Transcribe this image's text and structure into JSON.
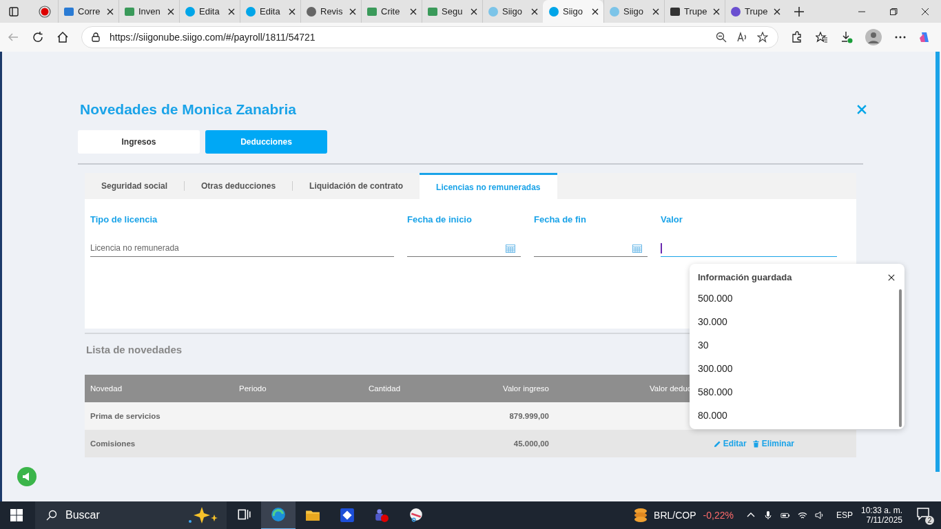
{
  "browser": {
    "tabs": [
      {
        "label": "Corre",
        "kind": "mail",
        "selected": false
      },
      {
        "label": "Inven",
        "kind": "sheet",
        "selected": false
      },
      {
        "label": "Edita",
        "kind": "siigo",
        "selected": false
      },
      {
        "label": "Edita",
        "kind": "siigo",
        "selected": false
      },
      {
        "label": "Revis",
        "kind": "chat",
        "selected": false
      },
      {
        "label": "Crite",
        "kind": "sheet",
        "selected": false
      },
      {
        "label": "Segu",
        "kind": "sheet",
        "selected": false
      },
      {
        "label": "Siigo",
        "kind": "siigo-light",
        "selected": false
      },
      {
        "label": "Siigo",
        "kind": "siigo",
        "selected": true
      },
      {
        "label": "Siigo",
        "kind": "siigo-light",
        "selected": false
      },
      {
        "label": "Trupe",
        "kind": "square",
        "selected": false
      },
      {
        "label": "Trupe",
        "kind": "circle",
        "selected": false
      }
    ],
    "url": "https://siigonube.siigo.com/#/payroll/1811/54721"
  },
  "page": {
    "title": "Novedades de Monica Zanabria",
    "main_tabs": [
      {
        "label": "Ingresos",
        "selected": false
      },
      {
        "label": "Deducciones",
        "selected": true
      }
    ],
    "sub_tabs": [
      {
        "label": "Seguridad social",
        "selected": false
      },
      {
        "label": "Otras deducciones",
        "selected": false
      },
      {
        "label": "Liquidación de contrato",
        "selected": false
      },
      {
        "label": "Licencias no remuneradas",
        "selected": true
      }
    ],
    "fields": [
      {
        "label": "Tipo de licencia",
        "kind": "text",
        "placeholder": "Licencia no remunerada",
        "focused": false
      },
      {
        "label": "Fecha de inicio",
        "kind": "date",
        "focused": false
      },
      {
        "label": "Fecha de fin",
        "kind": "date",
        "focused": false
      },
      {
        "label": "Valor",
        "kind": "text",
        "focused": true
      }
    ],
    "autocomplete": {
      "title": "Información guardada",
      "items": [
        "500.000",
        "30.000",
        "30",
        "300.000",
        "580.000",
        "80.000"
      ]
    },
    "list_title": "Lista de novedades",
    "table": {
      "columns": [
        "Novedad",
        "Periodo",
        "Cantidad",
        "Valor ingreso",
        "Valor deduc"
      ],
      "rows": [
        {
          "novedad": "Prima de servicios",
          "valor_ingreso": "879.999,00",
          "actions": []
        },
        {
          "novedad": "Comisiones",
          "valor_ingreso": "45.000,00",
          "actions": [
            {
              "label": "Editar",
              "kind": "edit"
            },
            {
              "label": "Eliminar",
              "kind": "delete"
            }
          ]
        }
      ]
    }
  },
  "taskbar": {
    "search_placeholder": "Buscar",
    "ticker": {
      "name": "BRL/COP",
      "change": "-0,22%"
    },
    "language": "ESP",
    "time": "10:33 a. m.",
    "date": "7/11/2025",
    "notifications": "2"
  }
}
